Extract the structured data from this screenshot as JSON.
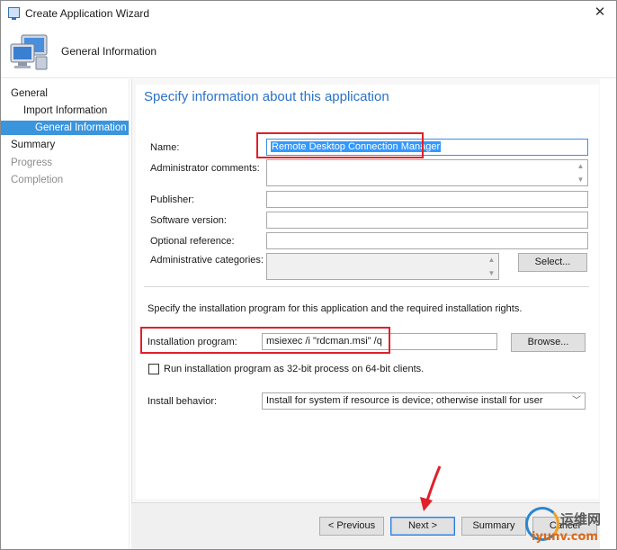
{
  "window": {
    "title": "Create Application Wizard",
    "close_glyph": "✕"
  },
  "header": {
    "title": "General Information",
    "icon": "computer-monitor-icon"
  },
  "nav": {
    "items": [
      {
        "label": "General",
        "level": 0,
        "state": "normal"
      },
      {
        "label": "Import Information",
        "level": 1,
        "state": "normal"
      },
      {
        "label": "General Information",
        "level": 2,
        "state": "active"
      },
      {
        "label": "Summary",
        "level": 0,
        "state": "normal"
      },
      {
        "label": "Progress",
        "level": 0,
        "state": "dim"
      },
      {
        "label": "Completion",
        "level": 0,
        "state": "dim"
      }
    ]
  },
  "form": {
    "heading": "Specify information about this application",
    "name_label": "Name:",
    "name_value": "Remote Desktop Connection Manager",
    "admin_comments_label": "Administrator comments:",
    "admin_comments_value": "",
    "publisher_label": "Publisher:",
    "publisher_value": "",
    "software_version_label": "Software version:",
    "software_version_value": "",
    "optional_reference_label": "Optional reference:",
    "optional_reference_value": "",
    "admin_categories_label": "Administrative categories:",
    "admin_categories_value": "",
    "select_button": "Select...",
    "install_instruction": "Specify the installation program for this application and the required installation rights.",
    "install_program_label": "Installation program:",
    "install_program_value": "msiexec /i \"rdcman.msi\" /q",
    "browse_button": "Browse...",
    "run_32bit_label": "Run installation program as 32-bit process on 64-bit clients.",
    "run_32bit_checked": false,
    "install_behavior_label": "Install behavior:",
    "install_behavior_value": "Install for system if resource is device; otherwise install for user"
  },
  "footer": {
    "previous_button": "< Previous",
    "next_button": "Next >",
    "summary_button": "Summary",
    "cancel_button": "Cancel"
  },
  "watermark": {
    "cn_text": "运维网",
    "en_text": "iyunv.com"
  },
  "colors": {
    "accent": "#2c72c7",
    "nav_active": "#3a95dd",
    "highlight_box": "#e0202a",
    "selection": "#3399ff"
  }
}
